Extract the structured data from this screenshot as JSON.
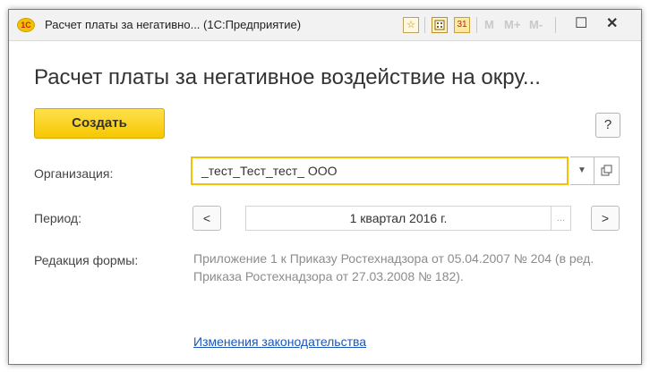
{
  "window": {
    "title": "Расчет платы за негативно... (1С:Предприятие)",
    "logo_text": "1С",
    "toolbar": {
      "m_label": "M",
      "m_plus_label": "M+",
      "m_minus_label": "M-"
    },
    "controls": {
      "minimize": "—",
      "maximize": "☐",
      "close": "✕"
    }
  },
  "form": {
    "heading": "Расчет платы за негативное воздействие на окру...",
    "create_label": "Создать",
    "help_label": "?",
    "organization": {
      "label": "Организация:",
      "value": "_тест_Тест_тест_ ООО"
    },
    "period": {
      "label": "Период:",
      "value": "1 квартал 2016 г.",
      "select_label": "...",
      "prev_label": "<",
      "next_label": ">"
    },
    "redaction": {
      "label": "Редакция формы:",
      "text": "Приложение 1 к Приказу Ростехнадзора от 05.04.2007 № 204 (в ред. Приказа Ростехнадзора от 27.03.2008 № 182)."
    },
    "law_link": "Изменения законодательства"
  },
  "colors": {
    "accent_yellow": "#f6c800",
    "link_blue": "#1a56b8",
    "logo_red": "#d01c1c"
  }
}
